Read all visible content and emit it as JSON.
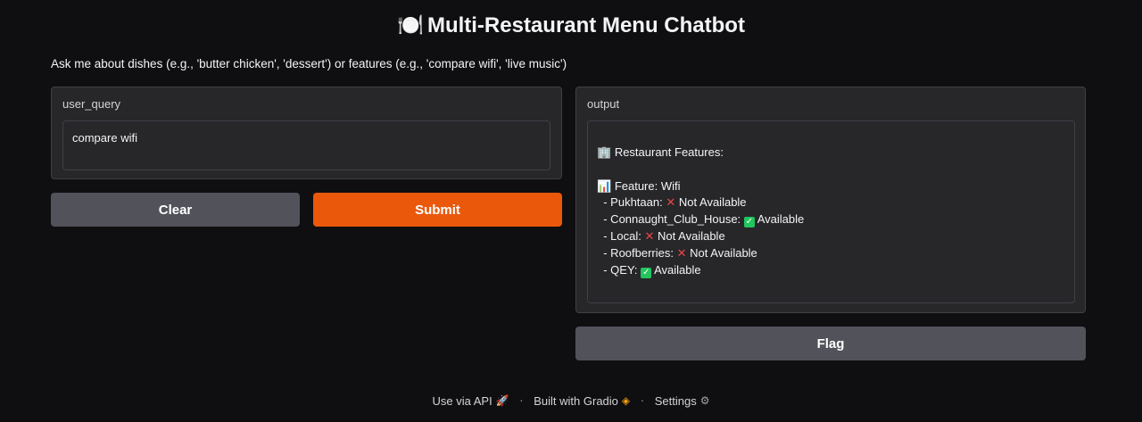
{
  "header": {
    "title_icon": "🍽️",
    "title": "Multi-Restaurant Menu Chatbot",
    "description": "Ask me about dishes (e.g., 'butter chicken', 'dessert') or features (e.g., 'compare wifi', 'live music')"
  },
  "input_panel": {
    "label": "user_query",
    "value": "compare wifi"
  },
  "buttons": {
    "clear": "Clear",
    "submit": "Submit",
    "flag": "Flag"
  },
  "output_panel": {
    "label": "output",
    "heading_icon": "🏢",
    "heading": "Restaurant Features:",
    "feature_icon": "📊",
    "feature": "Feature: Wifi",
    "items": [
      {
        "name": "- Pukhtaan:",
        "status": "Not Available",
        "available": false
      },
      {
        "name": "- Connaught_Club_House:",
        "status": "Available",
        "available": true
      },
      {
        "name": "- Local:",
        "status": "Not Available",
        "available": false
      },
      {
        "name": "- Roofberries:",
        "status": "Not Available",
        "available": false
      },
      {
        "name": "- QEY:",
        "status": "Available",
        "available": true
      }
    ]
  },
  "footer": {
    "api": "Use via API",
    "separator": "·",
    "built": "Built with Gradio",
    "settings": "Settings",
    "api_icon": "rocket-icon",
    "built_icon": "gradio-logo-icon",
    "settings_icon": "gear-icon"
  },
  "colors": {
    "background": "#0f0f11",
    "panel": "#27272a",
    "primary_button": "#ea580c",
    "secondary_button": "#52525b"
  }
}
